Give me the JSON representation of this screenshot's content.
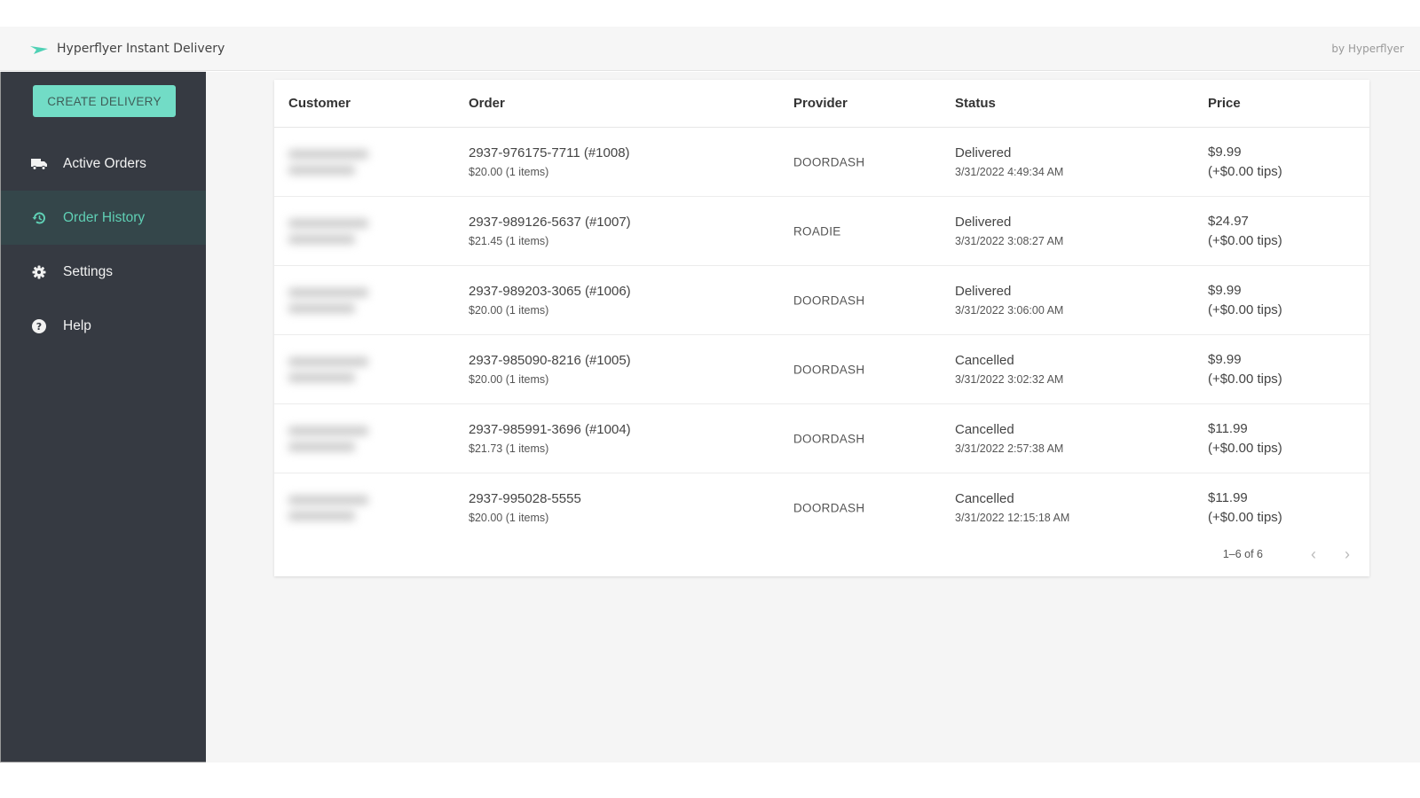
{
  "header": {
    "app_title": "Hyperflyer Instant Delivery",
    "by_label": "by Hyperflyer",
    "logo_icon": "paper-plane-icon",
    "brand_color": "#4fd1b5"
  },
  "sidebar": {
    "create_button_label": "CREATE DELIVERY",
    "items": [
      {
        "label": "Active Orders",
        "icon": "truck-icon",
        "active": false
      },
      {
        "label": "Order History",
        "icon": "history-icon",
        "active": true
      },
      {
        "label": "Settings",
        "icon": "gear-icon",
        "active": false
      },
      {
        "label": "Help",
        "icon": "help-circle-icon",
        "active": false
      }
    ],
    "accent_color": "#72dcc6"
  },
  "table": {
    "columns": [
      "Customer",
      "Order",
      "Provider",
      "Status",
      "Price"
    ],
    "rows": [
      {
        "customer": "(blurred)",
        "order_id": "2937-976175-7711 (#1008)",
        "order_detail": "$20.00 (1 items)",
        "provider": "DOORDASH",
        "status": "Delivered",
        "status_time": "3/31/2022 4:49:34 AM",
        "price": "$9.99",
        "tips": "(+$0.00 tips)"
      },
      {
        "customer": "(blurred)",
        "order_id": "2937-989126-5637 (#1007)",
        "order_detail": "$21.45 (1 items)",
        "provider": "ROADIE",
        "status": "Delivered",
        "status_time": "3/31/2022 3:08:27 AM",
        "price": "$24.97",
        "tips": "(+$0.00 tips)"
      },
      {
        "customer": "(blurred)",
        "order_id": "2937-989203-3065 (#1006)",
        "order_detail": "$20.00 (1 items)",
        "provider": "DOORDASH",
        "status": "Delivered",
        "status_time": "3/31/2022 3:06:00 AM",
        "price": "$9.99",
        "tips": "(+$0.00 tips)"
      },
      {
        "customer": "(blurred)",
        "order_id": "2937-985090-8216 (#1005)",
        "order_detail": "$20.00 (1 items)",
        "provider": "DOORDASH",
        "status": "Cancelled",
        "status_time": "3/31/2022 3:02:32 AM",
        "price": "$9.99",
        "tips": "(+$0.00 tips)"
      },
      {
        "customer": "(blurred)",
        "order_id": "2937-985991-3696 (#1004)",
        "order_detail": "$21.73 (1 items)",
        "provider": "DOORDASH",
        "status": "Cancelled",
        "status_time": "3/31/2022 2:57:38 AM",
        "price": "$11.99",
        "tips": "(+$0.00 tips)"
      },
      {
        "customer": "(blurred)",
        "order_id": "2937-995028-5555",
        "order_detail": "$20.00 (1 items)",
        "provider": "DOORDASH",
        "status": "Cancelled",
        "status_time": "3/31/2022 12:15:18 AM",
        "price": "$11.99",
        "tips": "(+$0.00 tips)"
      }
    ],
    "pagination": {
      "range_text": "1–6 of 6",
      "prev_icon": "chevron-left-icon",
      "next_icon": "chevron-right-icon"
    }
  }
}
